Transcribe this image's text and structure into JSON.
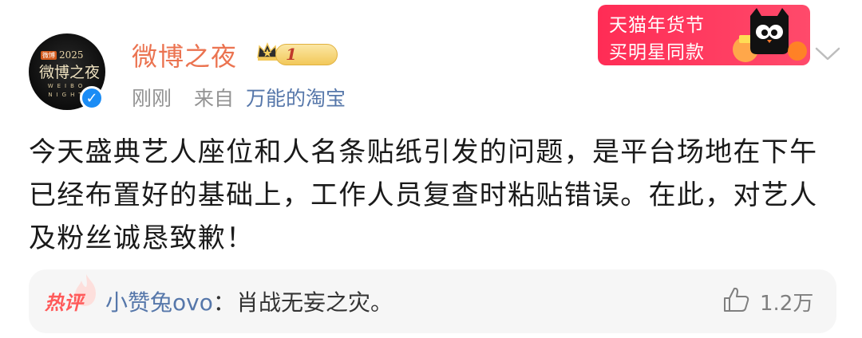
{
  "post": {
    "avatar": {
      "tag": "微博",
      "year": "2025",
      "title": "微博之夜",
      "sub1": "WEIBO",
      "sub2": "NIGHT"
    },
    "username": "微博之夜",
    "level": "1",
    "time": "刚刚",
    "from_label": "来自",
    "source": "万能的淘宝",
    "content": "今天盛典艺人座位和人名条贴纸引发的问题，是平台场地在下午已经布置好的基础上，工作人员复查时粘贴错误。在此，对艺人及粉丝诚恳致歉！"
  },
  "ad": {
    "line1": "天猫年货节",
    "line2": "买明星同款",
    "bg_color": "#ff2c55"
  },
  "hot_comment": {
    "badge": "热评",
    "user": "小赞兔ovo",
    "separator": "：",
    "text": "肖战无妄之灾。",
    "likes": "1.2万"
  },
  "colors": {
    "username": "#eb7350",
    "link": "#5677aa",
    "meta": "#939393",
    "verified": "#1b8cf5"
  }
}
